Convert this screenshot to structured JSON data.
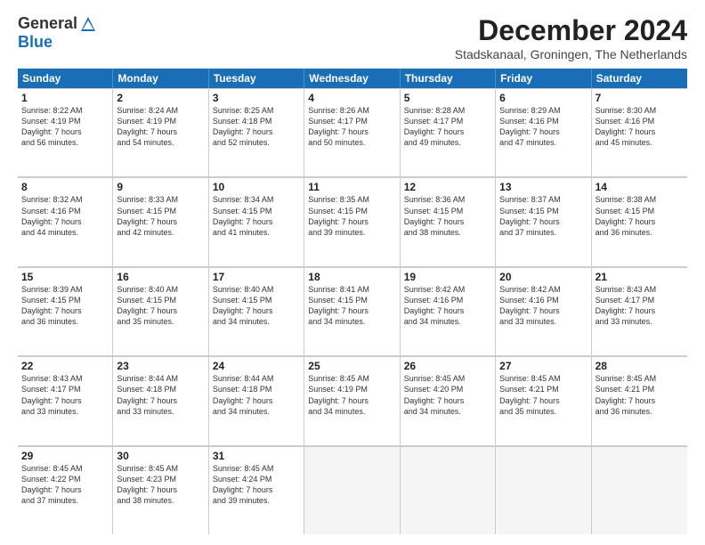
{
  "logo": {
    "general": "General",
    "blue": "Blue"
  },
  "title": "December 2024",
  "location": "Stadskanaal, Groningen, The Netherlands",
  "days": [
    "Sunday",
    "Monday",
    "Tuesday",
    "Wednesday",
    "Thursday",
    "Friday",
    "Saturday"
  ],
  "weeks": [
    [
      {
        "day": "1",
        "rise": "8:22 AM",
        "set": "4:19 PM",
        "daylight": "7 hours and 56 minutes."
      },
      {
        "day": "2",
        "rise": "8:24 AM",
        "set": "4:19 PM",
        "daylight": "7 hours and 54 minutes."
      },
      {
        "day": "3",
        "rise": "8:25 AM",
        "set": "4:18 PM",
        "daylight": "7 hours and 52 minutes."
      },
      {
        "day": "4",
        "rise": "8:26 AM",
        "set": "4:17 PM",
        "daylight": "7 hours and 50 minutes."
      },
      {
        "day": "5",
        "rise": "8:28 AM",
        "set": "4:17 PM",
        "daylight": "7 hours and 49 minutes."
      },
      {
        "day": "6",
        "rise": "8:29 AM",
        "set": "4:16 PM",
        "daylight": "7 hours and 47 minutes."
      },
      {
        "day": "7",
        "rise": "8:30 AM",
        "set": "4:16 PM",
        "daylight": "7 hours and 45 minutes."
      }
    ],
    [
      {
        "day": "8",
        "rise": "8:32 AM",
        "set": "4:16 PM",
        "daylight": "7 hours and 44 minutes."
      },
      {
        "day": "9",
        "rise": "8:33 AM",
        "set": "4:15 PM",
        "daylight": "7 hours and 42 minutes."
      },
      {
        "day": "10",
        "rise": "8:34 AM",
        "set": "4:15 PM",
        "daylight": "7 hours and 41 minutes."
      },
      {
        "day": "11",
        "rise": "8:35 AM",
        "set": "4:15 PM",
        "daylight": "7 hours and 39 minutes."
      },
      {
        "day": "12",
        "rise": "8:36 AM",
        "set": "4:15 PM",
        "daylight": "7 hours and 38 minutes."
      },
      {
        "day": "13",
        "rise": "8:37 AM",
        "set": "4:15 PM",
        "daylight": "7 hours and 37 minutes."
      },
      {
        "day": "14",
        "rise": "8:38 AM",
        "set": "4:15 PM",
        "daylight": "7 hours and 36 minutes."
      }
    ],
    [
      {
        "day": "15",
        "rise": "8:39 AM",
        "set": "4:15 PM",
        "daylight": "7 hours and 36 minutes."
      },
      {
        "day": "16",
        "rise": "8:40 AM",
        "set": "4:15 PM",
        "daylight": "7 hours and 35 minutes."
      },
      {
        "day": "17",
        "rise": "8:40 AM",
        "set": "4:15 PM",
        "daylight": "7 hours and 34 minutes."
      },
      {
        "day": "18",
        "rise": "8:41 AM",
        "set": "4:15 PM",
        "daylight": "7 hours and 34 minutes."
      },
      {
        "day": "19",
        "rise": "8:42 AM",
        "set": "4:16 PM",
        "daylight": "7 hours and 34 minutes."
      },
      {
        "day": "20",
        "rise": "8:42 AM",
        "set": "4:16 PM",
        "daylight": "7 hours and 33 minutes."
      },
      {
        "day": "21",
        "rise": "8:43 AM",
        "set": "4:17 PM",
        "daylight": "7 hours and 33 minutes."
      }
    ],
    [
      {
        "day": "22",
        "rise": "8:43 AM",
        "set": "4:17 PM",
        "daylight": "7 hours and 33 minutes."
      },
      {
        "day": "23",
        "rise": "8:44 AM",
        "set": "4:18 PM",
        "daylight": "7 hours and 33 minutes."
      },
      {
        "day": "24",
        "rise": "8:44 AM",
        "set": "4:18 PM",
        "daylight": "7 hours and 34 minutes."
      },
      {
        "day": "25",
        "rise": "8:45 AM",
        "set": "4:19 PM",
        "daylight": "7 hours and 34 minutes."
      },
      {
        "day": "26",
        "rise": "8:45 AM",
        "set": "4:20 PM",
        "daylight": "7 hours and 34 minutes."
      },
      {
        "day": "27",
        "rise": "8:45 AM",
        "set": "4:21 PM",
        "daylight": "7 hours and 35 minutes."
      },
      {
        "day": "28",
        "rise": "8:45 AM",
        "set": "4:21 PM",
        "daylight": "7 hours and 36 minutes."
      }
    ],
    [
      {
        "day": "29",
        "rise": "8:45 AM",
        "set": "4:22 PM",
        "daylight": "7 hours and 37 minutes."
      },
      {
        "day": "30",
        "rise": "8:45 AM",
        "set": "4:23 PM",
        "daylight": "7 hours and 38 minutes."
      },
      {
        "day": "31",
        "rise": "8:45 AM",
        "set": "4:24 PM",
        "daylight": "7 hours and 39 minutes."
      },
      null,
      null,
      null,
      null
    ]
  ]
}
